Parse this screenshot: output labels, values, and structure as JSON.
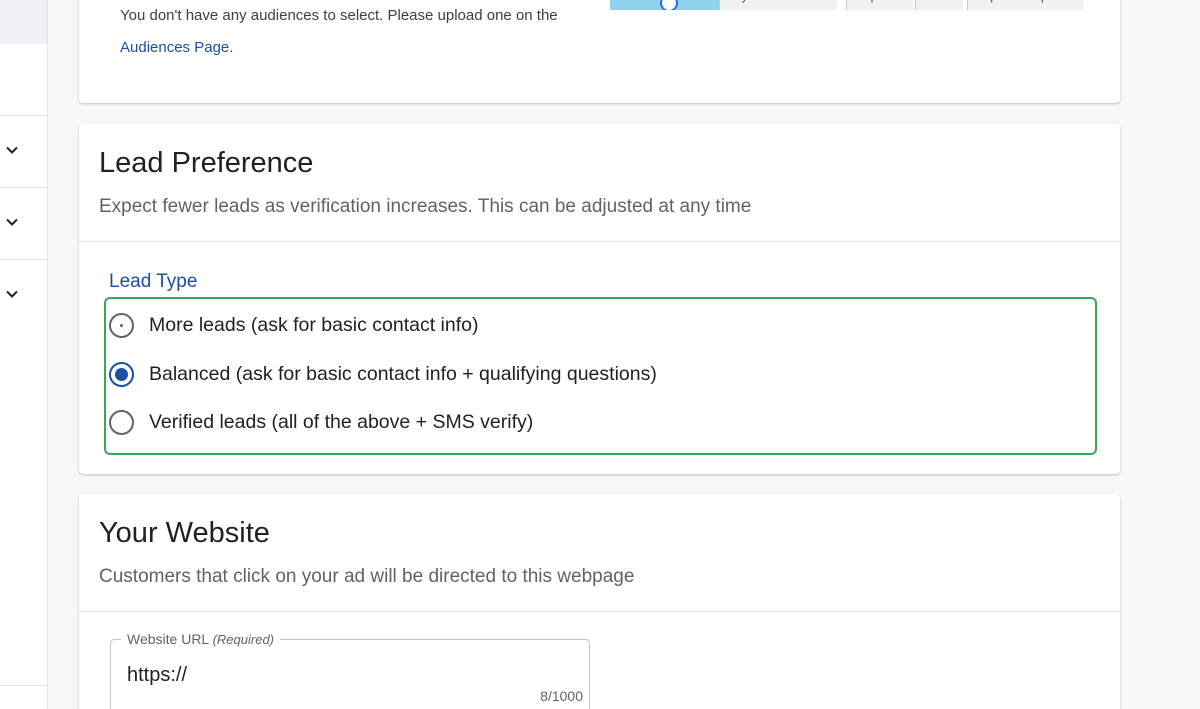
{
  "audiences": {
    "message": "You don't have any audiences to select. Please upload one on the",
    "link_text": "Audiences Page",
    "link_suffix": "."
  },
  "map_attribution": {
    "items": [
      "Keyboard shortcuts",
      "Map Data",
      "Terms",
      "Report a map error"
    ]
  },
  "lead_preference": {
    "title": "Lead Preference",
    "subtitle": "Expect fewer leads as verification increases. This can be adjusted at any time",
    "lead_type_label": "Lead Type",
    "options": [
      {
        "label": "More leads (ask for basic contact info)",
        "selected": false
      },
      {
        "label": "Balanced (ask for basic contact info + qualifying questions)",
        "selected": true
      },
      {
        "label": "Verified leads (all of the above + SMS verify)",
        "selected": false
      }
    ],
    "highlight_color": "#34a853"
  },
  "website": {
    "title": "Your Website",
    "subtitle": "Customers that click on your ad will be directed to this webpage",
    "url_label": "Website URL",
    "url_required": "(Required)",
    "url_value": "https://",
    "url_counter": "8/1000"
  },
  "sidebar": {
    "icons": [
      "chevron-down-icon",
      "chevron-down-icon",
      "chevron-down-icon"
    ]
  },
  "colors": {
    "link": "#1a4fa3",
    "radio_selected": "#1a4fa3",
    "highlight": "#34a853"
  }
}
